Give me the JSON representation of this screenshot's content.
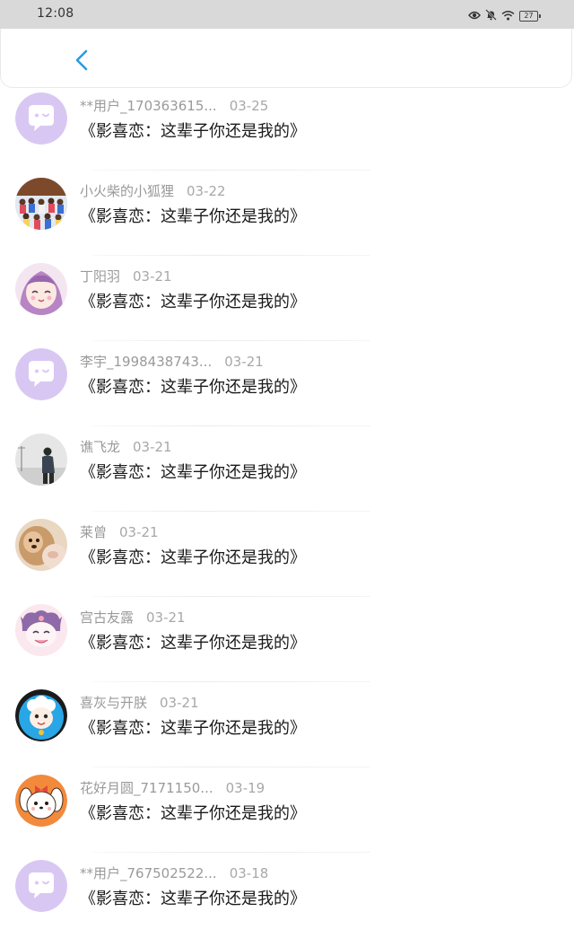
{
  "status": {
    "time": "12:08",
    "battery": "27",
    "icons": [
      "eye-icon",
      "bell-off-icon",
      "wifi-icon",
      "battery-icon"
    ]
  },
  "header": {
    "back_icon": "chevron-left-icon",
    "accent_color": "#2b9be0"
  },
  "message": "《影喜恋：这辈子你还是我的》",
  "rows": [
    {
      "user": "**用户_170363615...",
      "date": "03-25",
      "avatar": "chat-bubble"
    },
    {
      "user": "小火柴的小狐狸",
      "date": "03-22",
      "avatar": "group-photo"
    },
    {
      "user": "丁阳羽",
      "date": "03-21",
      "avatar": "anime-girl"
    },
    {
      "user": "李宇_1998438743...",
      "date": "03-21",
      "avatar": "chat-bubble"
    },
    {
      "user": "谯飞龙",
      "date": "03-21",
      "avatar": "person-photo"
    },
    {
      "user": "莱曾",
      "date": "03-21",
      "avatar": "pet-photo"
    },
    {
      "user": "宫古友露",
      "date": "03-21",
      "avatar": "kuromi-cartoon"
    },
    {
      "user": "喜灰与开朕",
      "date": "03-21",
      "avatar": "sheep-cartoon"
    },
    {
      "user": "花好月圆_7171150...",
      "date": "03-19",
      "avatar": "puppy-cartoon"
    },
    {
      "user": "**用户_767502522...",
      "date": "03-18",
      "avatar": "chat-bubble"
    }
  ]
}
